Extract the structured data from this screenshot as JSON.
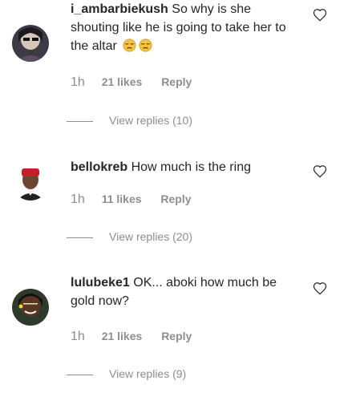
{
  "comments": [
    {
      "username": "i_ambarbiekush",
      "text": "So why is she shouting like he is going to take her to the altar",
      "emoji_icon": "unamused-face-icon",
      "time": "1h",
      "likes": "21 likes",
      "reply_label": "Reply",
      "view_replies": "View replies (10)"
    },
    {
      "username": "bellokreb",
      "text": "How much is the ring",
      "time": "1h",
      "likes": "11 likes",
      "reply_label": "Reply",
      "view_replies": "View replies (20)"
    },
    {
      "username": "lulubeke1",
      "text": "OK... aboki how much be gold now?",
      "time": "1h",
      "likes": "21 likes",
      "reply_label": "Reply",
      "view_replies": "View replies (9)"
    }
  ],
  "icons": {
    "like": "heart-outline-icon",
    "emoji": "unamused-face-icon"
  },
  "colors": {
    "text": "#262626",
    "secondary": "#8e8e8e",
    "emoji": "#f6c343"
  }
}
